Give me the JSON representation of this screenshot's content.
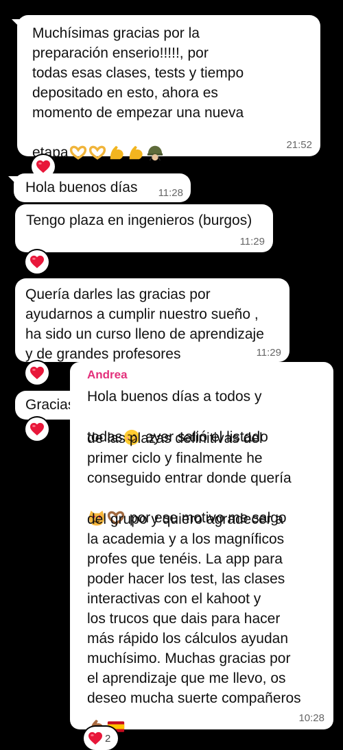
{
  "messages": [
    {
      "text": "Muchísimas gracias por la\npreparación enserio!!!!!, por\ntodas esas clases, tests y tiempo\ndepositado en esto, ahora es\nmomento de empezar una nueva",
      "tail_text": "etapa",
      "time": "21:52"
    },
    {
      "text": "Hola buenos días",
      "time": "11:28"
    },
    {
      "text": "Tengo plaza en ingenieros (burgos)",
      "time": "11:29"
    },
    {
      "text": "Quería darles las gracias por\nayudarnos a cumplir nuestro sueño ,\nha sido un curso lleno de aprendizaje\ny de grandes profesores",
      "time": "11:29"
    },
    {
      "text": "Gracias"
    },
    {
      "sender": "Andrea",
      "line1": "Hola buenos días a todos y",
      "line2": "todas",
      "line2b": " ayer salió el listado",
      "block1": "de las plazas definitivas del\nprimer ciclo y finalmente he\nconseguido entrar donde quería",
      "line_emoji": " por ese motivo me salgo",
      "block2": "del grupo y quiero agradecer a\nla academia y a los magníficos\nprofes que tenéis. La app para\npoder hacer los test, las clases\ninteractivas con el kahoot y\nlos trucos que dais para hacer\nmás rápido los cálculos ayudan\nmuchísimo. Muchas gracias por\nel aprendizaje que me llevo, os\ndeseo mucha suerte compañeros",
      "time": "10:28",
      "reaction_count": "2"
    }
  ],
  "emojis": [
    "heart-hands",
    "heart-hands",
    "flexed-biceps",
    "flexed-biceps",
    "military-helmet",
    "smiling-face",
    "heart-eyes-cat",
    "heart-hands",
    "flexed-biceps",
    "spain-flag"
  ],
  "colors": {
    "background": "#000000",
    "bubble": "#ffffff",
    "sender": "#e3307b",
    "heart": "#e8173a"
  }
}
